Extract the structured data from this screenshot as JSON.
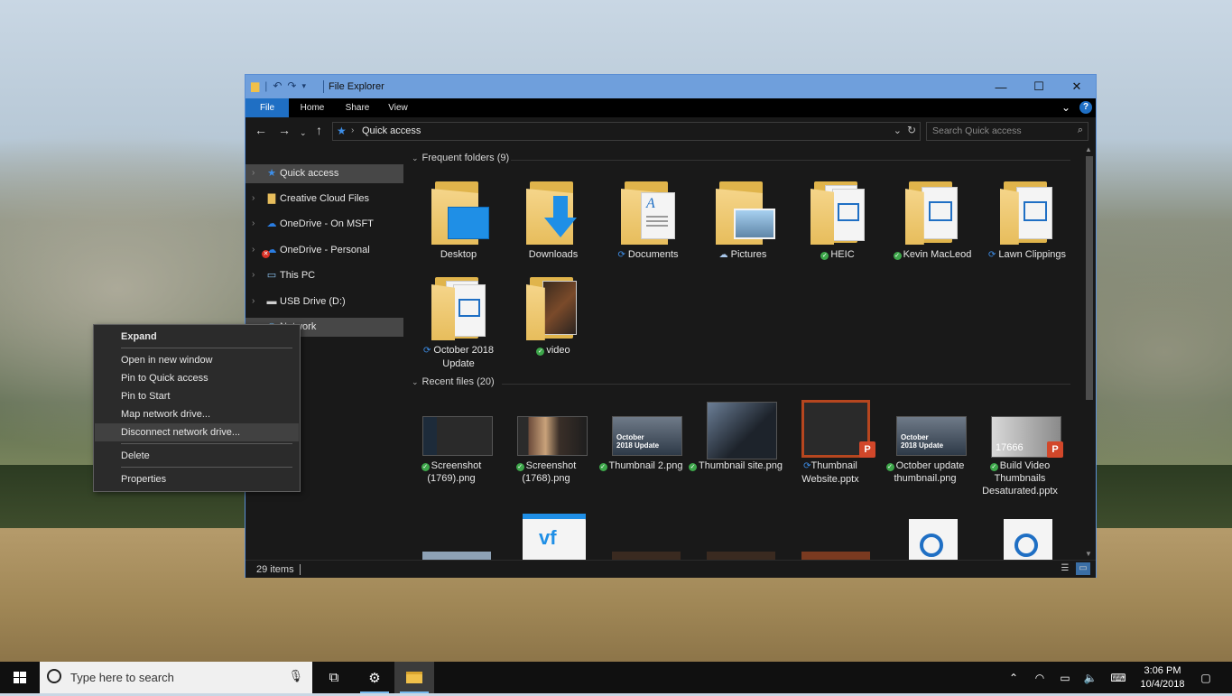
{
  "window": {
    "title": "File Explorer",
    "controls": {
      "minimize": "—",
      "maximize": "☐",
      "close": "✕"
    }
  },
  "ribbon": {
    "tabs": [
      {
        "label": "File"
      },
      {
        "label": "Home"
      },
      {
        "label": "Share"
      },
      {
        "label": "View"
      }
    ]
  },
  "address": {
    "path": "Quick access",
    "search_placeholder": "Search Quick access"
  },
  "nav": {
    "items": [
      {
        "label": "Quick access",
        "icon": "star-icon"
      },
      {
        "label": "Creative Cloud Files",
        "icon": "creative-cloud-icon"
      },
      {
        "label": "OneDrive - On MSFT",
        "icon": "onedrive-icon"
      },
      {
        "label": "OneDrive - Personal",
        "icon": "onedrive-error-icon"
      },
      {
        "label": "This PC",
        "icon": "computer-icon"
      },
      {
        "label": "USB Drive (D:)",
        "icon": "usb-drive-icon"
      },
      {
        "label": "Network",
        "icon": "network-icon"
      }
    ]
  },
  "frequent": {
    "header": "Frequent folders (9)",
    "folders": [
      {
        "label": "Desktop",
        "status": ""
      },
      {
        "label": "Downloads",
        "status": ""
      },
      {
        "label": "Documents",
        "status": "sync"
      },
      {
        "label": "Pictures",
        "status": "cloud"
      },
      {
        "label": "HEIC",
        "status": "ok"
      },
      {
        "label": "Kevin MacLeod",
        "status": "ok"
      },
      {
        "label": "Lawn Clippings",
        "status": "sync"
      },
      {
        "label": "October 2018 Update",
        "status": "sync"
      },
      {
        "label": "video",
        "status": "ok"
      }
    ]
  },
  "recent": {
    "header": "Recent files (20)",
    "files": [
      {
        "label": "Screenshot (1769).png",
        "status": "ok"
      },
      {
        "label": "Screenshot (1768).png",
        "status": "ok"
      },
      {
        "label": "Thumbnail 2.png",
        "status": "ok",
        "overlay": "October 2018 Update"
      },
      {
        "label": "Thumbnail site.png",
        "status": "ok"
      },
      {
        "label": "Thumbnail Website.pptx",
        "status": "sync"
      },
      {
        "label": "October update thumbnail.png",
        "status": "ok",
        "overlay": "October 2018 Update"
      },
      {
        "label": "Build Video Thumbnails Desaturated.pptx",
        "status": "ok",
        "overlay": "17666"
      }
    ]
  },
  "status": {
    "count": "29 items"
  },
  "context_menu": {
    "items": [
      {
        "label": "Expand"
      },
      {
        "label": "Open in new window"
      },
      {
        "label": "Pin to Quick access"
      },
      {
        "label": "Pin to Start"
      },
      {
        "label": "Map network drive..."
      },
      {
        "label": "Disconnect network drive..."
      },
      {
        "label": "Delete"
      },
      {
        "label": "Properties"
      }
    ]
  },
  "taskbar": {
    "search_placeholder": "Type here to search",
    "time": "3:06 PM",
    "date": "10/4/2018"
  },
  "colors": {
    "accent": "#1f6fc4",
    "titlebar": "#6f9fdc",
    "folder": "#e7bd5c",
    "sync_ok": "#3da64a"
  }
}
